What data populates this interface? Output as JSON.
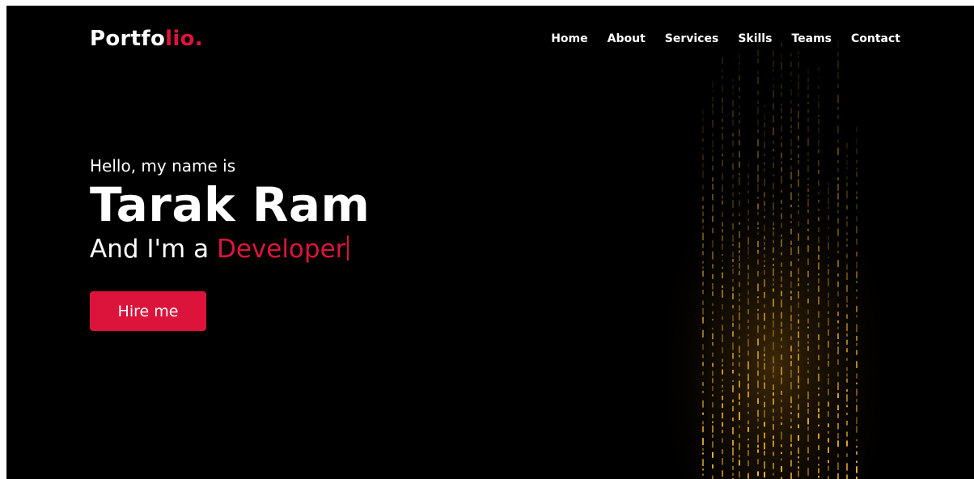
{
  "brand": {
    "logo_main": "Portfo",
    "logo_accent": "lio."
  },
  "nav": {
    "items": [
      {
        "label": "Home"
      },
      {
        "label": "About"
      },
      {
        "label": "Services"
      },
      {
        "label": "Skills"
      },
      {
        "label": "Teams"
      },
      {
        "label": "Contact"
      }
    ]
  },
  "hero": {
    "greeting": "Hello, my name is",
    "name": "Tarak Ram",
    "role_prefix": "And I'm a ",
    "role_typed": "Developer",
    "cta_label": "Hire me"
  },
  "colors": {
    "accent": "#dc143c",
    "background": "#000000",
    "text": "#ffffff",
    "stream_glow": "#f5b52a"
  }
}
